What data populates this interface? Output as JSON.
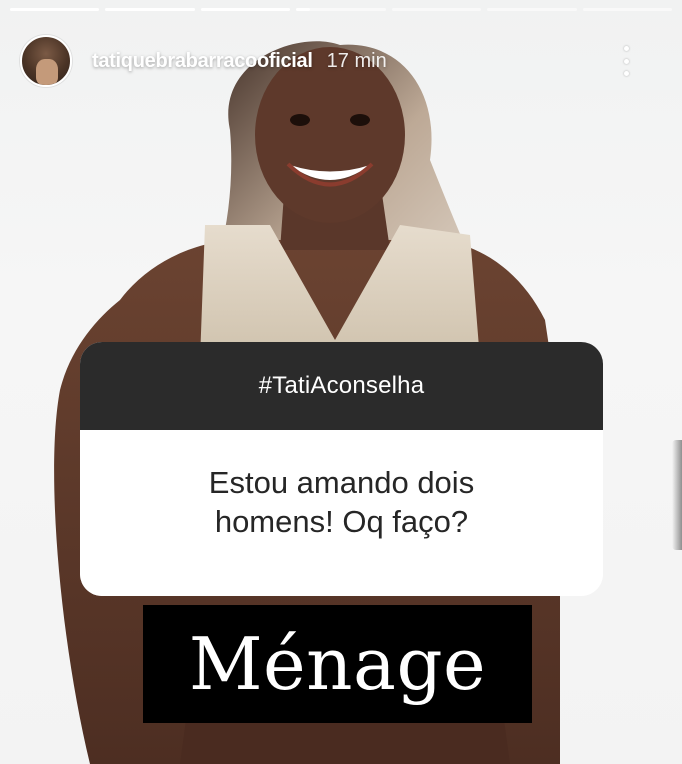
{
  "story": {
    "progress": [
      1,
      1,
      1,
      0.15,
      0,
      0,
      0
    ],
    "username": "tatiquebrabarracooficial",
    "time_ago": "17 min"
  },
  "question_sticker": {
    "title": "#TatiAconselha",
    "question": "Estou amando dois homens! Oq faço?"
  },
  "answer": {
    "text": "Ménage"
  },
  "colors": {
    "sticker_header": "#2b2b2b",
    "answer_background": "#000000",
    "text_dark": "#262626"
  },
  "icons": {
    "more": "more-vertical-icon"
  }
}
